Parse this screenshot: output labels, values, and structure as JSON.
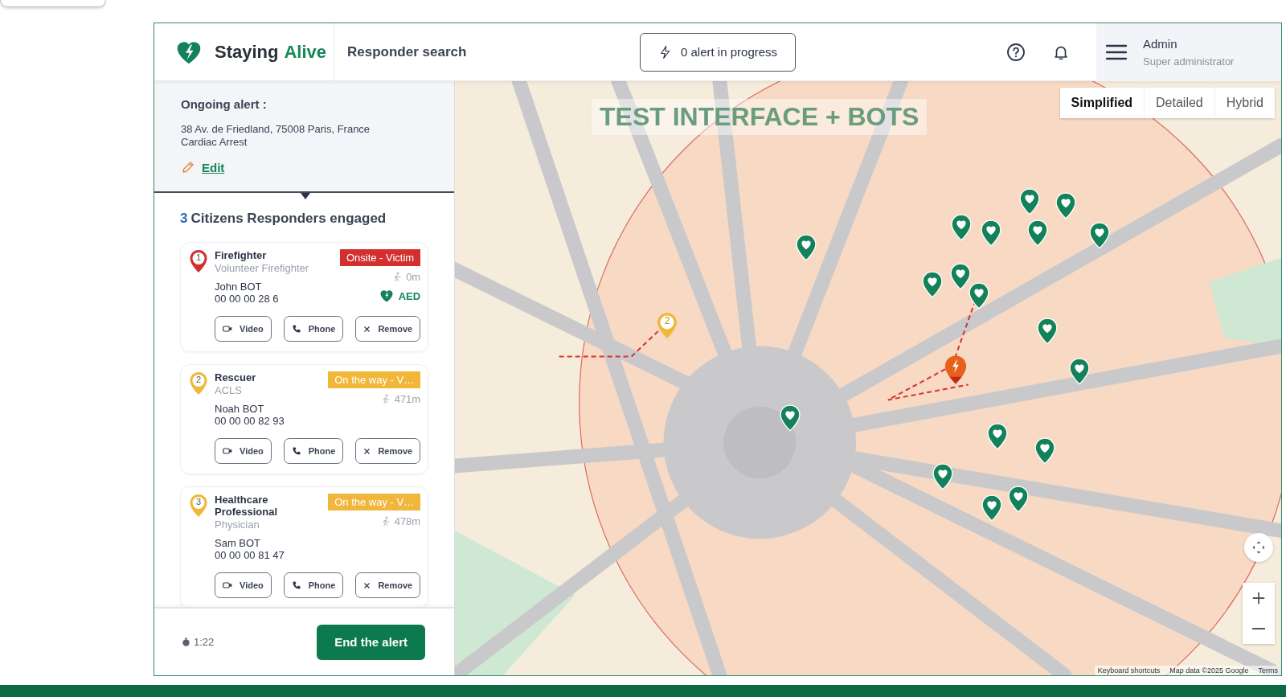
{
  "header": {
    "brand_first": "Staying",
    "brand_second": "Alive",
    "page_title": "Responder search",
    "alert_button": "0 alert in progress",
    "user": {
      "name": "Admin",
      "role": "Super administrator"
    }
  },
  "alert_panel": {
    "heading": "Ongoing alert :",
    "address": "38 Av. de Friedland, 75008 Paris, France",
    "type": "Cardiac Arrest",
    "edit_link": "Edit"
  },
  "responders_heading": {
    "count": "3",
    "label": "Citizens Responders engaged"
  },
  "responders": [
    {
      "number": "1",
      "color": "#d32f2f",
      "title": "Firefighter",
      "subtitle": "Volunteer Firefighter",
      "name": "John BOT",
      "phone": "00 00 00 28 6",
      "status": "Onsite - Victim",
      "distance": "0m",
      "aed": "AED",
      "buttons": [
        "Video",
        "Phone",
        "Remove"
      ]
    },
    {
      "number": "2",
      "color": "#f0b73a",
      "title": "Rescuer",
      "subtitle": "ACLS",
      "name": "Noah BOT",
      "phone": "00 00 00 82 93",
      "status": "On the way - V…",
      "distance": "471m",
      "buttons": [
        "Video",
        "Phone",
        "Remove"
      ]
    },
    {
      "number": "3",
      "color": "#f0b73a",
      "title": "Healthcare Professional",
      "subtitle": "Physician",
      "name": "Sam BOT",
      "phone": "00 00 00 81 47",
      "status": "On the way - V…",
      "distance": "478m",
      "buttons": [
        "Video",
        "Phone",
        "Remove"
      ]
    }
  ],
  "footer": {
    "timer": "1:22",
    "end_button": "End the alert"
  },
  "map": {
    "banner": "TEST INTERFACE + BOTS",
    "map_types": [
      {
        "label": "Simplified",
        "selected": true
      },
      {
        "label": "Detailed",
        "selected": false
      },
      {
        "label": "Hybrid",
        "selected": false
      }
    ],
    "markers": [
      {
        "kind": "responder",
        "label": "2",
        "color": "#f0b73a"
      },
      {
        "kind": "alert"
      },
      {
        "kind": "aed"
      },
      {
        "kind": "aed"
      },
      {
        "kind": "aed"
      },
      {
        "kind": "aed"
      },
      {
        "kind": "aed"
      },
      {
        "kind": "aed"
      },
      {
        "kind": "aed"
      },
      {
        "kind": "aed"
      },
      {
        "kind": "aed"
      },
      {
        "kind": "aed"
      },
      {
        "kind": "aed"
      },
      {
        "kind": "aed"
      },
      {
        "kind": "aed"
      },
      {
        "kind": "aed"
      },
      {
        "kind": "aed"
      },
      {
        "kind": "aed"
      },
      {
        "kind": "aed"
      },
      {
        "kind": "aed"
      }
    ],
    "attribution": [
      "Keyboard shortcuts",
      "Map data ©2025 Google",
      "Terms"
    ]
  }
}
